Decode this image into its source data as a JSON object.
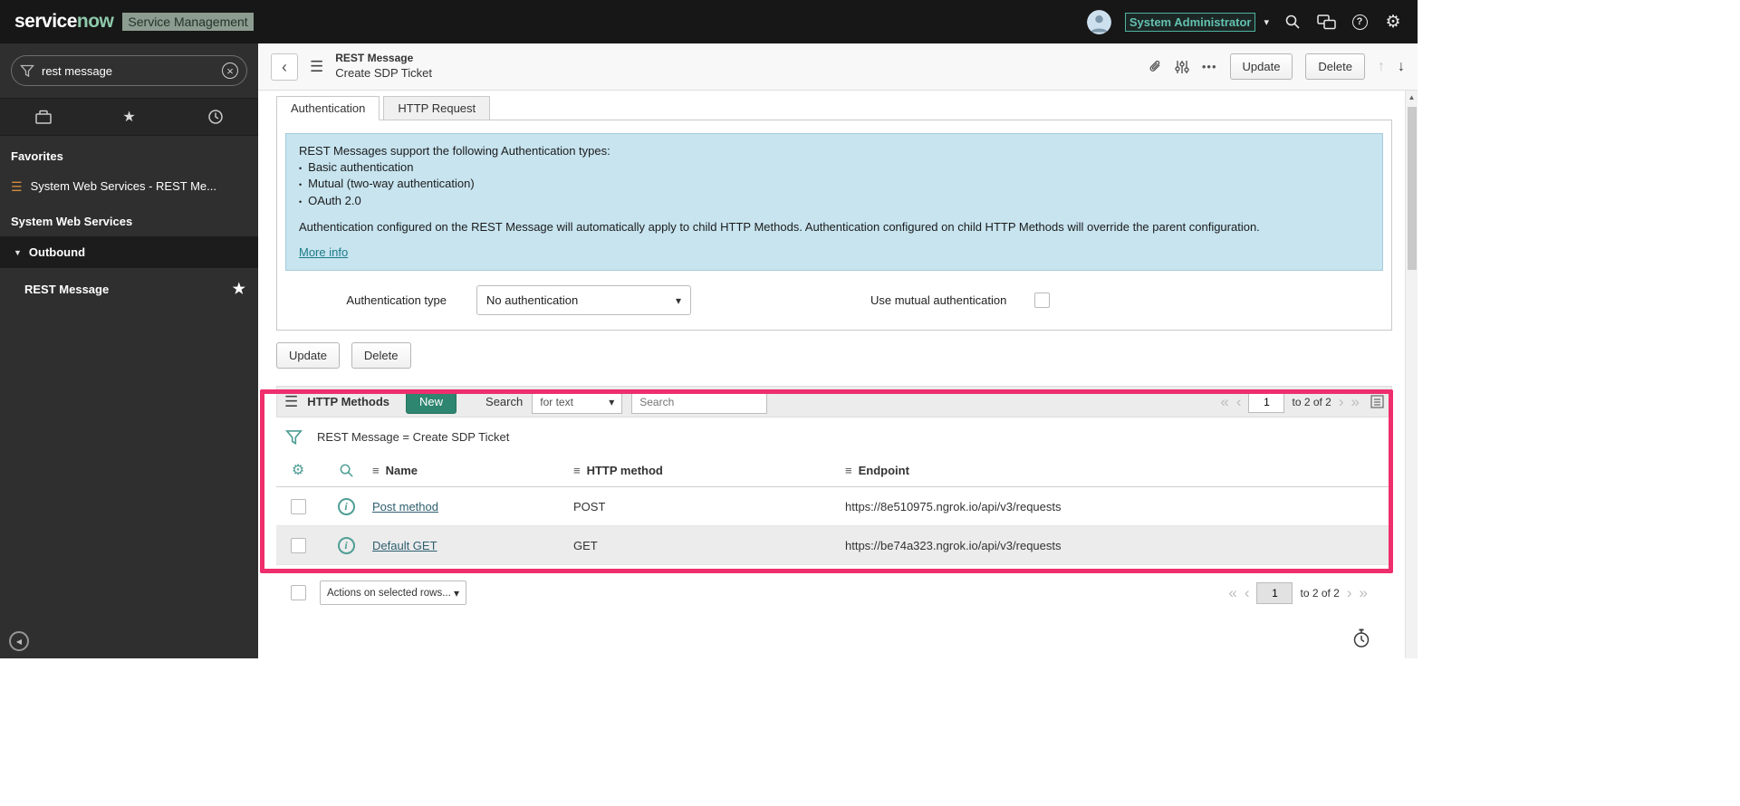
{
  "colors": {
    "annotation_pink": "#ee2e6d",
    "accent_teal": "#4f9e95",
    "new_button_green": "#2e8570",
    "info_box_blue": "#c7e4ef"
  },
  "icons": {
    "hamburger": "☰",
    "star": "★",
    "caret_down": "▾",
    "triangle_down": "▼",
    "back_chevron": "‹",
    "dots": "•••",
    "up_arrow": "↑",
    "down_arrow": "↓",
    "gear": "⚙",
    "clear_x": "×",
    "first": "«",
    "prev": "‹",
    "next": "›",
    "last": "»",
    "collapse_left": "◀",
    "scroll_up": "▲",
    "bullet": "•",
    "column_menu": "≡",
    "question": "?",
    "info_i": "i"
  },
  "header": {
    "logo_service": "service",
    "logo_now": "now",
    "product_label": "Service Management",
    "user_name": "System Administrator"
  },
  "sidebar": {
    "search_value": "rest message",
    "favorites_label": "Favorites",
    "favorite_item": "System Web Services - REST Me...",
    "application_title": "System Web Services",
    "group_label": "Outbound",
    "module_label": "REST Message"
  },
  "form": {
    "record_type": "REST Message",
    "record_title": "Create SDP Ticket",
    "header_buttons": {
      "update": "Update",
      "delete": "Delete"
    },
    "tabs": [
      {
        "label": "Authentication"
      },
      {
        "label": "HTTP Request"
      }
    ],
    "info": {
      "intro": "REST Messages support the following Authentication types:",
      "items": [
        "Basic authentication",
        "Mutual (two-way authentication)",
        "OAuth 2.0"
      ],
      "note": "Authentication configured on the REST Message will automatically apply to child HTTP Methods. Authentication configured on child HTTP Methods will override the parent configuration.",
      "more_info_link": "More info"
    },
    "fields": {
      "auth_type_label": "Authentication type",
      "auth_type_value": "No authentication",
      "mutual_auth_label": "Use mutual authentication"
    },
    "footer_buttons": {
      "update": "Update",
      "delete": "Delete"
    }
  },
  "list": {
    "title": "HTTP Methods",
    "new_button": "New",
    "search_label": "Search",
    "search_scope": "for text",
    "search_placeholder": "Search",
    "breadcrumb": "REST Message = Create SDP Ticket",
    "columns": {
      "name": "Name",
      "method": "HTTP method",
      "endpoint": "Endpoint"
    },
    "rows": [
      {
        "name": "Post method",
        "method": "POST",
        "endpoint": "https://8e510975.ngrok.io/api/v3/requests"
      },
      {
        "name": "Default GET",
        "method": "GET",
        "endpoint": "https://be74a323.ngrok.io/api/v3/requests"
      }
    ],
    "pagination": {
      "page": "1",
      "range": "to 2 of 2"
    },
    "actions_select": "Actions on selected rows..."
  }
}
